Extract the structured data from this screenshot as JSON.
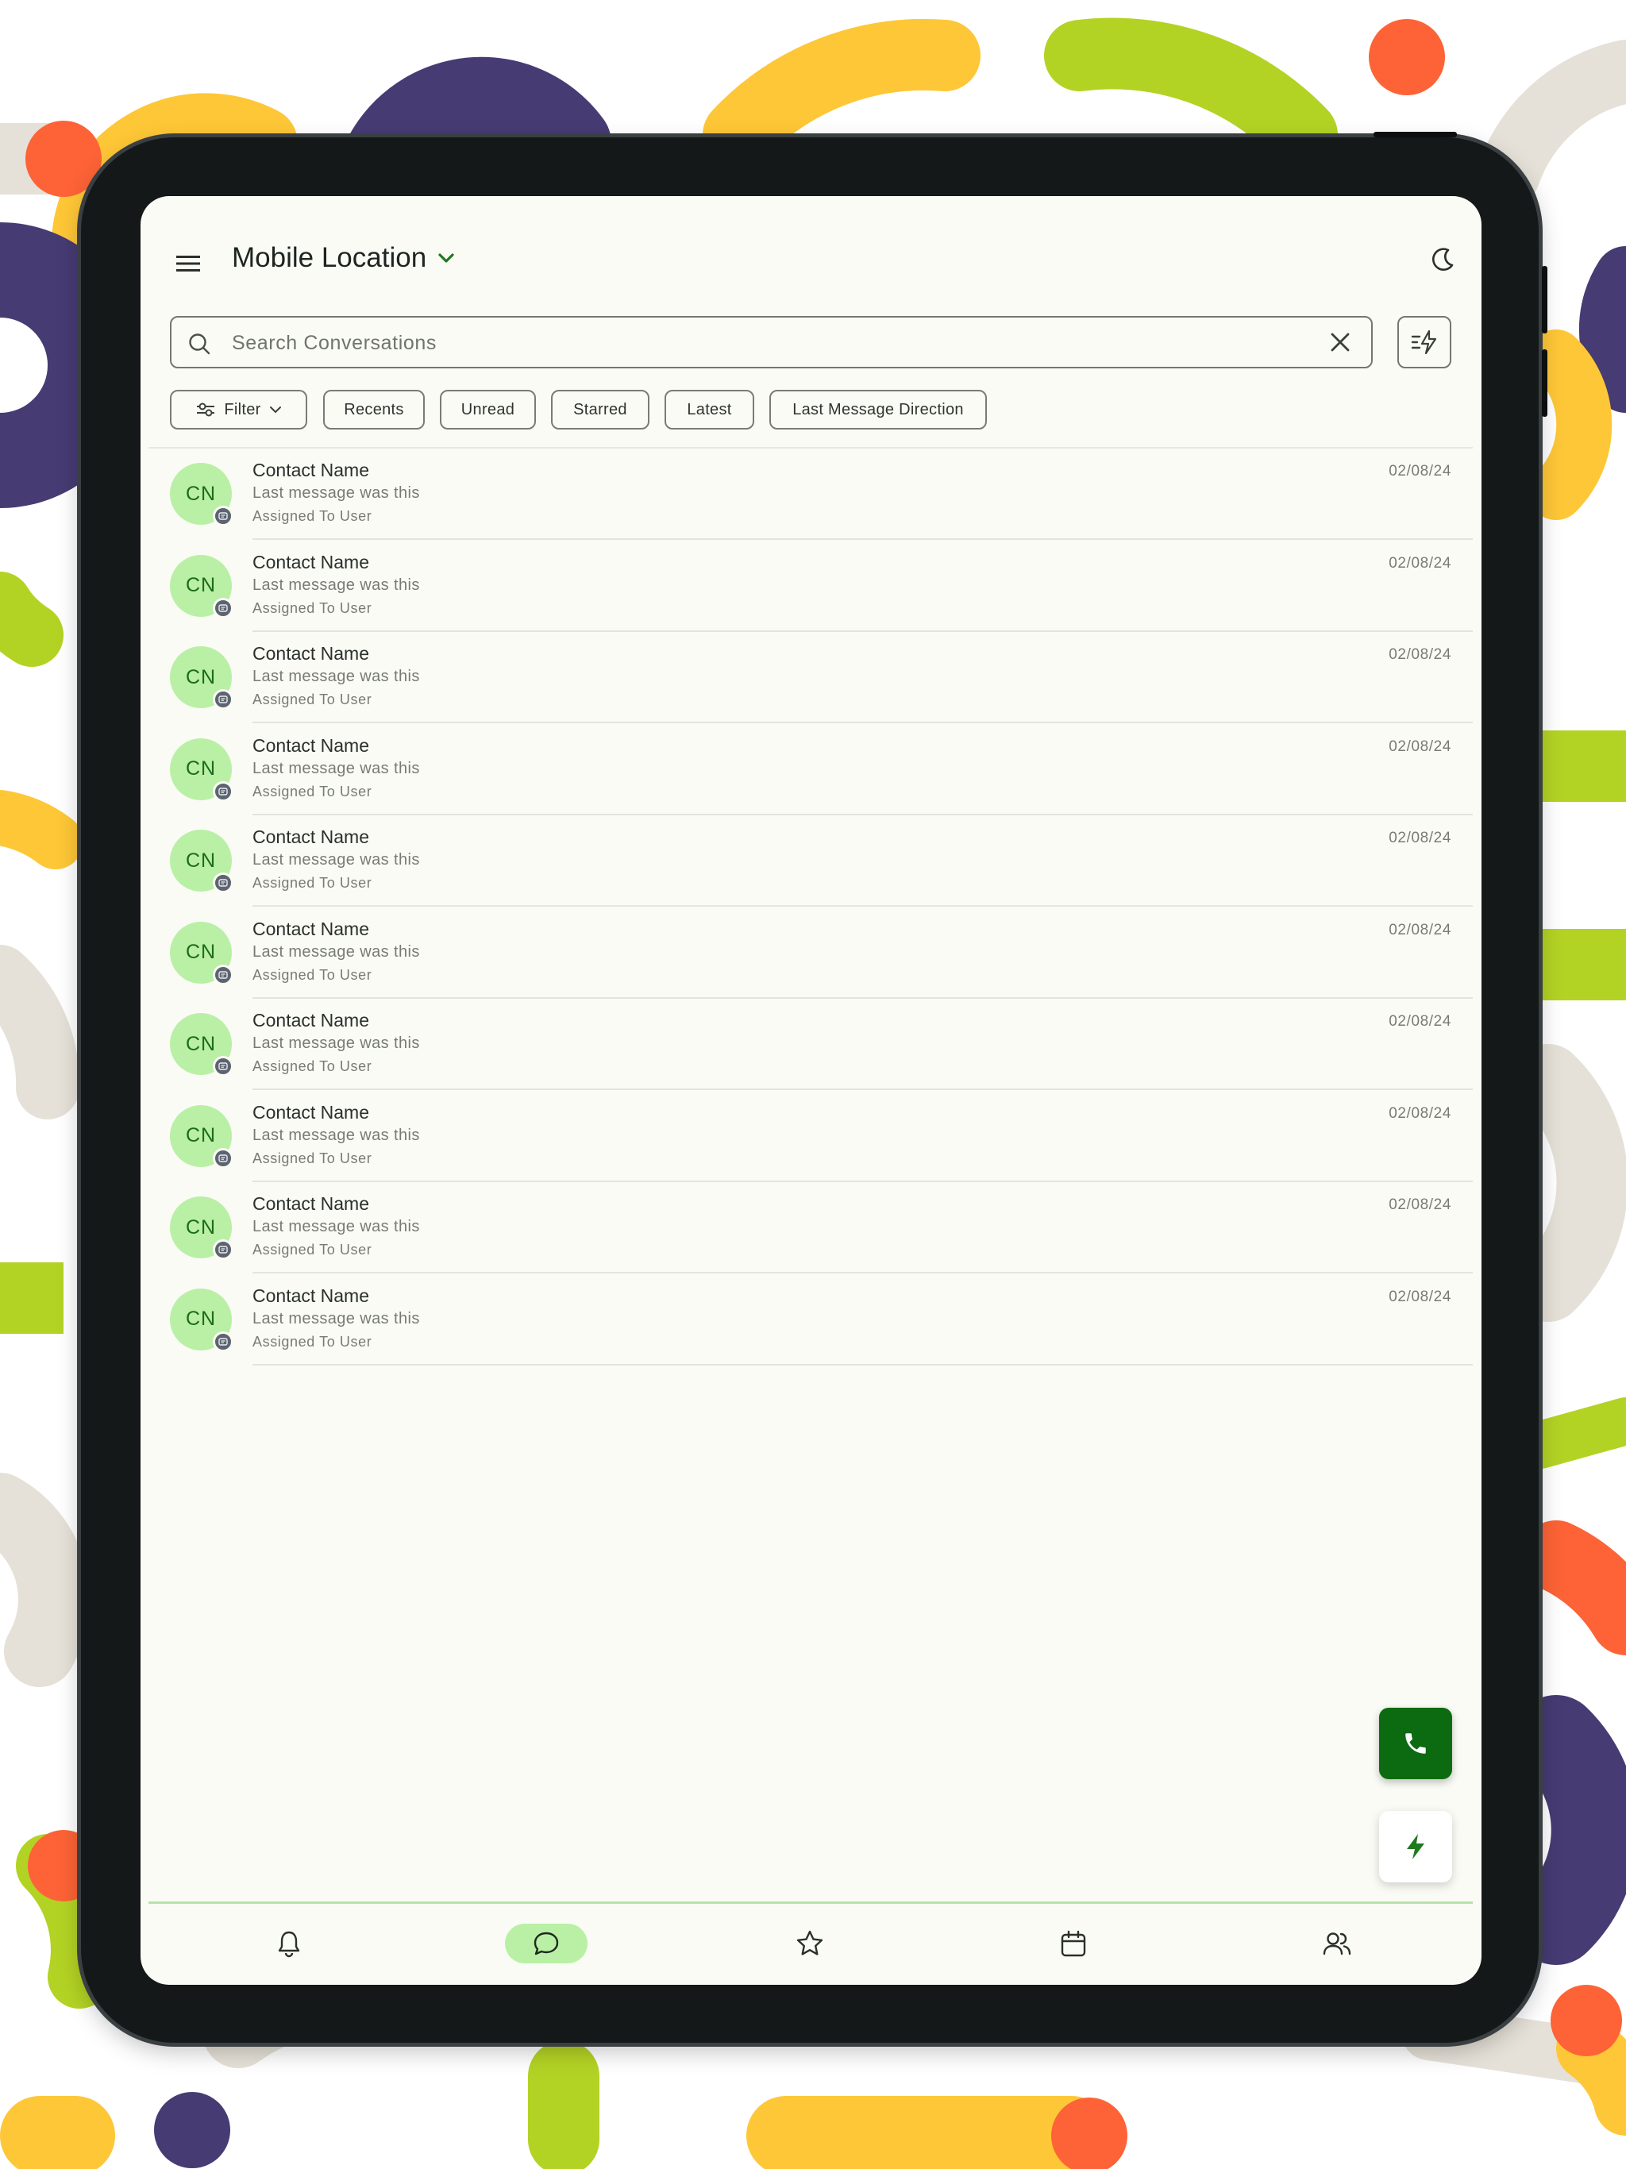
{
  "header": {
    "title": "Mobile Location"
  },
  "search": {
    "placeholder": "Search Conversations"
  },
  "chips": [
    {
      "label": "Filter"
    },
    {
      "label": "Recents"
    },
    {
      "label": "Unread"
    },
    {
      "label": "Starred"
    },
    {
      "label": "Latest"
    },
    {
      "label": "Last Message Direction"
    }
  ],
  "conversations": [
    {
      "initials": "CN",
      "name": "Contact Name",
      "message": "Last message was this",
      "assigned": "Assigned To User",
      "date": "02/08/24"
    },
    {
      "initials": "CN",
      "name": "Contact Name",
      "message": "Last message was this",
      "assigned": "Assigned To User",
      "date": "02/08/24"
    },
    {
      "initials": "CN",
      "name": "Contact Name",
      "message": "Last message was this",
      "assigned": "Assigned To User",
      "date": "02/08/24"
    },
    {
      "initials": "CN",
      "name": "Contact Name",
      "message": "Last message was this",
      "assigned": "Assigned To User",
      "date": "02/08/24"
    },
    {
      "initials": "CN",
      "name": "Contact Name",
      "message": "Last message was this",
      "assigned": "Assigned To User",
      "date": "02/08/24"
    },
    {
      "initials": "CN",
      "name": "Contact Name",
      "message": "Last message was this",
      "assigned": "Assigned To User",
      "date": "02/08/24"
    },
    {
      "initials": "CN",
      "name": "Contact Name",
      "message": "Last message was this",
      "assigned": "Assigned To User",
      "date": "02/08/24"
    },
    {
      "initials": "CN",
      "name": "Contact Name",
      "message": "Last message was this",
      "assigned": "Assigned To User",
      "date": "02/08/24"
    },
    {
      "initials": "CN",
      "name": "Contact Name",
      "message": "Last message was this",
      "assigned": "Assigned To User",
      "date": "02/08/24"
    },
    {
      "initials": "CN",
      "name": "Contact Name",
      "message": "Last message was this",
      "assigned": "Assigned To User",
      "date": "02/08/24"
    }
  ],
  "bottom_nav": [
    {
      "icon": "bell-icon",
      "active": false
    },
    {
      "icon": "chat-icon",
      "active": true
    },
    {
      "icon": "star-icon",
      "active": false
    },
    {
      "icon": "calendar-icon",
      "active": false
    },
    {
      "icon": "contacts-icon",
      "active": false
    }
  ],
  "colors": {
    "accent": "#0c6b11",
    "avatar_bg": "#b9f0a6",
    "screen_bg": "#fbfbf6"
  }
}
